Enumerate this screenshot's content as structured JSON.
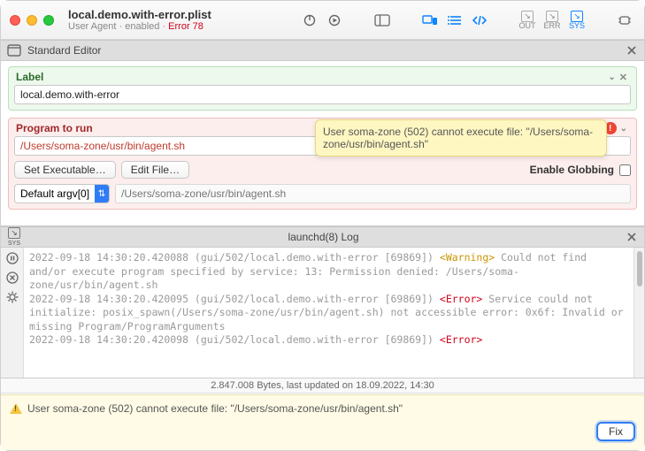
{
  "window": {
    "filename": "local.demo.with-error.plist",
    "subtitle_kind": "User Agent",
    "subtitle_state": "enabled",
    "subtitle_error": "Error 78"
  },
  "toolbar": {
    "out_label": "OUT",
    "err_label": "ERR",
    "sys_label": "SYS"
  },
  "editor": {
    "section_title": "Standard Editor",
    "label_group": {
      "title": "Label",
      "value": "local.demo.with-error"
    },
    "program_group": {
      "title": "Program to run",
      "value": "/Users/soma-zone/usr/bin/agent.sh",
      "set_exec_btn": "Set Executable…",
      "edit_file_btn": "Edit File…",
      "enable_globbing": "Enable Globbing",
      "argv_label": "Default argv[0]",
      "argv_placeholder": "/Users/soma-zone/usr/bin/agent.sh",
      "tooltip": "User soma-zone (502) cannot execute file: \"/Users/soma-zone/usr/bin/agent.sh\""
    }
  },
  "log": {
    "section_title": "launchd(8) Log",
    "lines": [
      {
        "prefix": "2022-09-18 14:30:20.420088 (gui/502/local.demo.with-error [69869]) ",
        "tag": "<Warning>",
        "tagClass": "warn-tag",
        "rest": " Could not find and/or execute program specified by service: 13: Permission denied: /Users/soma-zone/usr/bin/agent.sh"
      },
      {
        "prefix": "2022-09-18 14:30:20.420095 (gui/502/local.demo.with-error [69869]) ",
        "tag": "<Error>",
        "tagClass": "err-tag",
        "rest": " Service could not initialize: posix_spawn(/Users/soma-zone/usr/bin/agent.sh) not accessible error: 0x6f: Invalid or missing Program/ProgramArguments"
      },
      {
        "prefix": "2022-09-18 14:30:20.420098 (gui/502/local.demo.with-error [69869]) ",
        "tag": "<Error>",
        "tagClass": "err-tag",
        "rest": ""
      }
    ],
    "status": "2.847.008 Bytes, last updated on 18.09.2022, 14:30"
  },
  "footer": {
    "message": "User soma-zone (502) cannot execute file: \"/Users/soma-zone/usr/bin/agent.sh\"",
    "fix_label": "Fix"
  }
}
